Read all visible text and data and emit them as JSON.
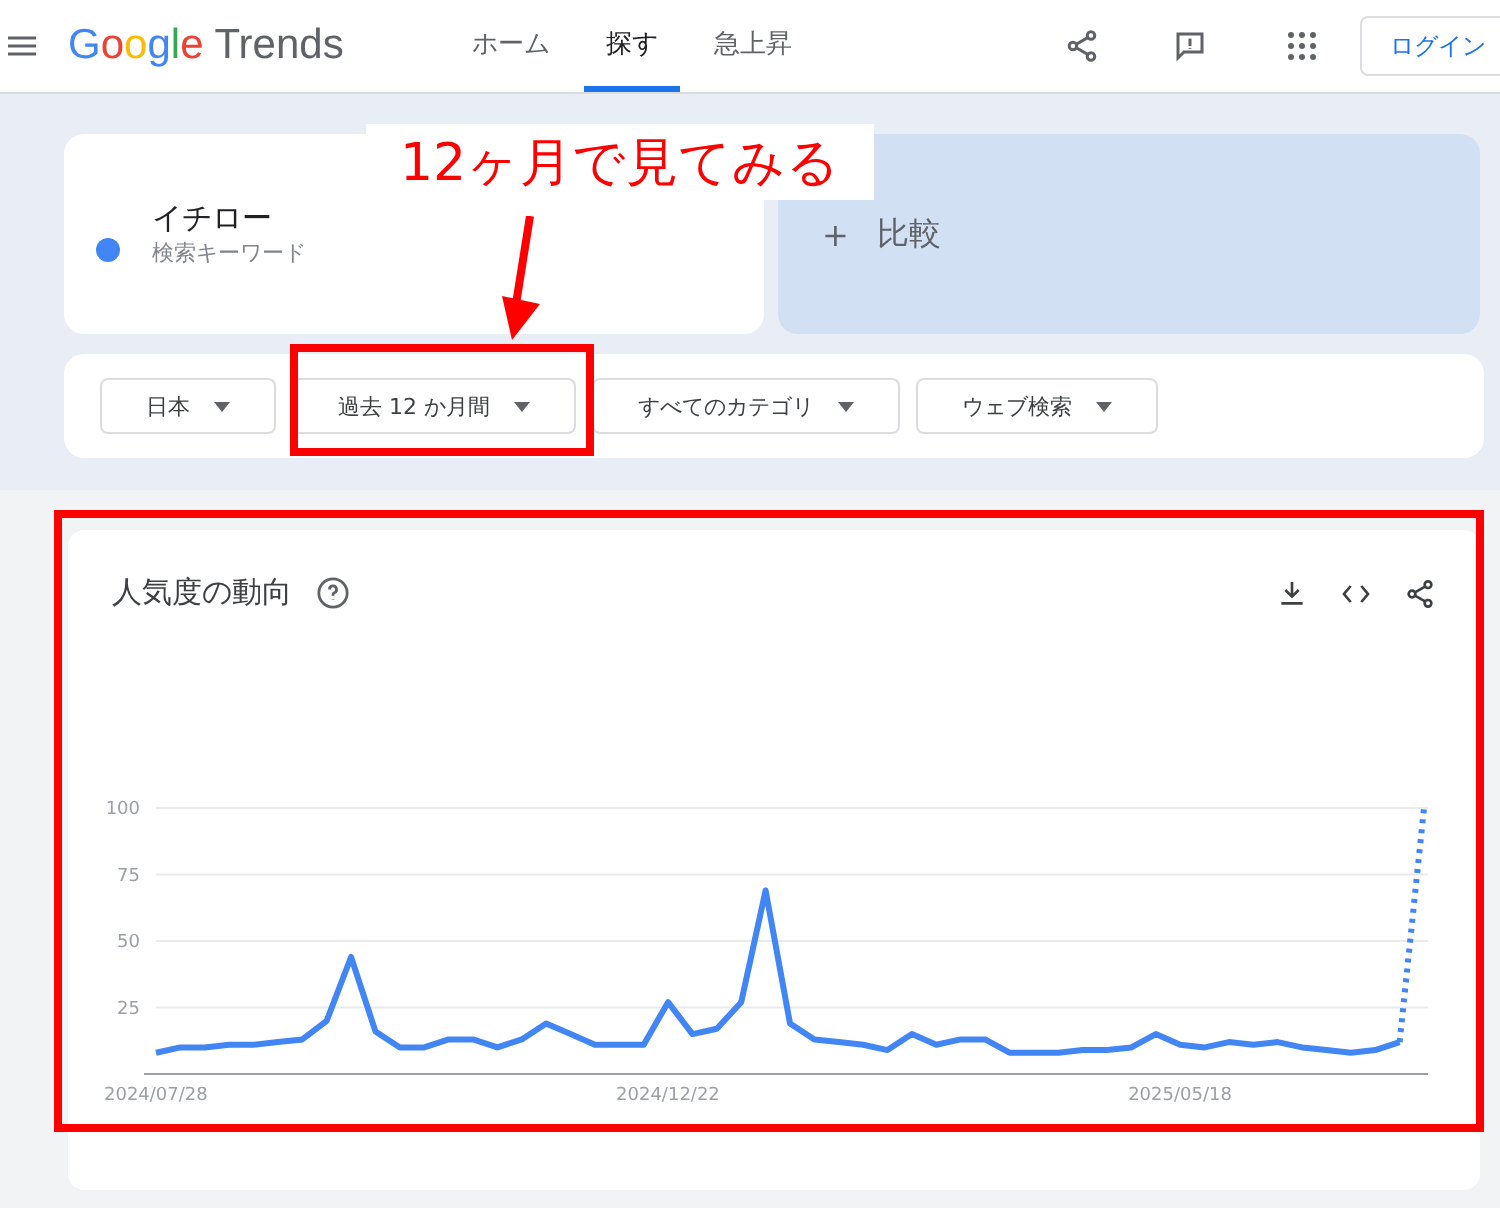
{
  "header": {
    "logo": {
      "brand": "Google",
      "product": "Trends"
    },
    "nav": [
      {
        "label": "ホーム",
        "selected": false
      },
      {
        "label": "探す",
        "selected": true
      },
      {
        "label": "急上昇",
        "selected": false
      }
    ],
    "login": "ログイン"
  },
  "search_term": {
    "term": "イチロー",
    "subtitle": "検索キーワード",
    "color": "#4285f4"
  },
  "compare": {
    "icon": "+",
    "label": "比較"
  },
  "filters": [
    {
      "label": "日本"
    },
    {
      "label": "過去 12 か月間"
    },
    {
      "label": "すべてのカテゴリ"
    },
    {
      "label": "ウェブ検索"
    }
  ],
  "annotation": {
    "text": "12ヶ月で見てみる"
  },
  "trend": {
    "title": "人気度の動向",
    "chart_data": {
      "type": "line",
      "categories": [
        "2024/07/28",
        null,
        null,
        null,
        null,
        null,
        null,
        null,
        null,
        null,
        null,
        null,
        null,
        null,
        null,
        null,
        null,
        null,
        null,
        null,
        null,
        "2024/12/22",
        null,
        null,
        null,
        null,
        null,
        null,
        null,
        null,
        null,
        null,
        null,
        null,
        null,
        null,
        null,
        null,
        null,
        null,
        null,
        null,
        "2025/05/18",
        null,
        null,
        null,
        null,
        null,
        null,
        null,
        null,
        null,
        null
      ],
      "ylim": [
        0,
        100
      ],
      "grid": true,
      "yticks": [
        25,
        50,
        75,
        100
      ],
      "series": [
        {
          "color": "#4285f4",
          "values": [
            8,
            10,
            10,
            11,
            11,
            12,
            13,
            20,
            44,
            16,
            10,
            10,
            13,
            13,
            10,
            13,
            19,
            15,
            11,
            11,
            11,
            27,
            15,
            17,
            27,
            69,
            19,
            13,
            12,
            11,
            9,
            15,
            11,
            13,
            13,
            8,
            8,
            8,
            9,
            9,
            10,
            15,
            11,
            10,
            12,
            11,
            12,
            10,
            9,
            8,
            9,
            12,
            null
          ]
        },
        {
          "color": "#4285f4",
          "line_style": "dotted",
          "values": [
            null,
            null,
            null,
            null,
            null,
            null,
            null,
            null,
            null,
            null,
            null,
            null,
            null,
            null,
            null,
            null,
            null,
            null,
            null,
            null,
            null,
            null,
            null,
            null,
            null,
            null,
            null,
            null,
            null,
            null,
            null,
            null,
            null,
            null,
            null,
            null,
            null,
            null,
            null,
            null,
            null,
            null,
            null,
            null,
            null,
            null,
            null,
            null,
            null,
            null,
            null,
            12,
            100
          ]
        }
      ]
    }
  }
}
